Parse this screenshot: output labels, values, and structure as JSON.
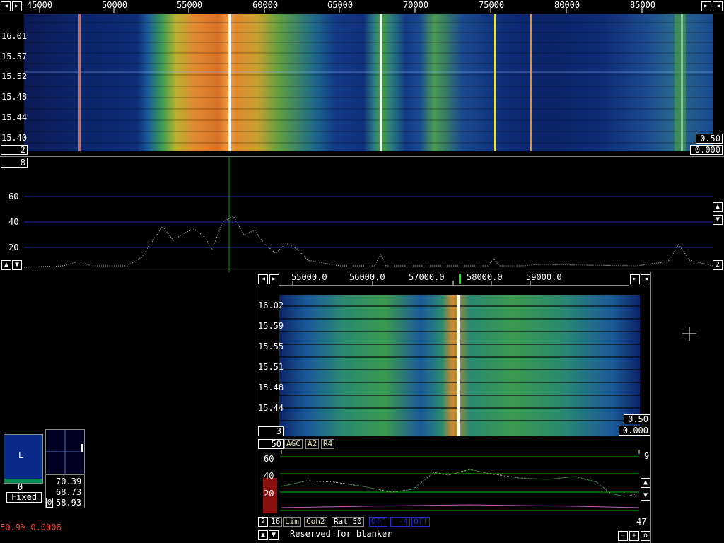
{
  "top": {
    "freq_ticks": [
      "45000",
      "50000",
      "55000",
      "60000",
      "65000",
      "70000",
      "75000",
      "80000",
      "85000"
    ],
    "time_labels": [
      "16.01",
      "15.57",
      "15.52",
      "15.48",
      "15.44",
      "15.40"
    ],
    "gain_value": "0.50",
    "offset_value": "0.000",
    "avg_value": "2",
    "spectrum_avg": "8",
    "db_labels": [
      "60",
      "40",
      "20"
    ],
    "zoom_value": "2"
  },
  "bottom": {
    "freq_ticks": [
      "55000.0",
      "56000.0",
      "57000.0",
      "58000.0",
      "59000.0"
    ],
    "time_labels": [
      "16.02",
      "15.59",
      "15.55",
      "15.51",
      "15.48",
      "15.44"
    ],
    "gain_value": "0.50",
    "offset_value": "0.000",
    "avg_value": "3",
    "bw_value": "50",
    "chips1": [
      "AGC",
      "A2",
      "R4"
    ],
    "db_labels": [
      "60",
      "40",
      "20"
    ],
    "right_value": "9",
    "row2": {
      "zoom": "2",
      "n": "16",
      "lim": "Lim",
      "coh": "Coh2",
      "rat": "Rat 50",
      "off1": "Off",
      "mid": "-4",
      "off2": "Off"
    },
    "right_number": "47",
    "status_text": "Reserved for blanker"
  },
  "meter": {
    "label": "L",
    "value": "0",
    "mode": "Fixed"
  },
  "readouts": [
    "70.39",
    "68.73",
    "58.93"
  ],
  "readout_zero": "0",
  "footer_status": "50.9% 0.0006",
  "icons": [
    "left-arrow-icon",
    "right-arrow-icon",
    "up-arrow-icon",
    "down-arrow-icon",
    "crosshair-icon",
    "minus-icon",
    "plus-icon"
  ],
  "colors": {
    "accent_green": "#00ff00",
    "footer_red": "#ff4040",
    "meter_blue": "#0a2a8a",
    "grid_blue": "#1a2fb0"
  }
}
